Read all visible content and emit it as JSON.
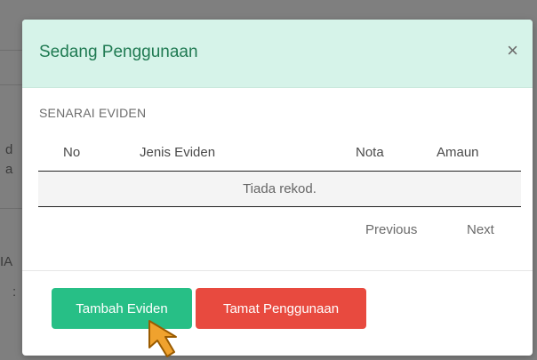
{
  "modal": {
    "title": "Sedang Penggunaan",
    "close_icon": "close-icon",
    "section_label": "SENARAI EVIDEN",
    "table": {
      "columns": [
        "No",
        "Jenis Eviden",
        "Nota",
        "Amaun"
      ],
      "empty_text": "Tiada rekod."
    },
    "pagination": {
      "previous": "Previous",
      "next": "Next"
    },
    "buttons": {
      "add": "Tambah Eviden",
      "finish": "Tamat Penggunaan"
    }
  },
  "background": {
    "partial_texts": [
      "d",
      "a",
      "IA",
      ":"
    ]
  },
  "colors": {
    "header_bg": "#d6f3e9",
    "title_color": "#1f7a52",
    "add_button": "#27bf86",
    "finish_button": "#e84a3f",
    "cursor": "#f0a22e"
  },
  "cursor_icon": "hand-pointer-arrow-icon"
}
